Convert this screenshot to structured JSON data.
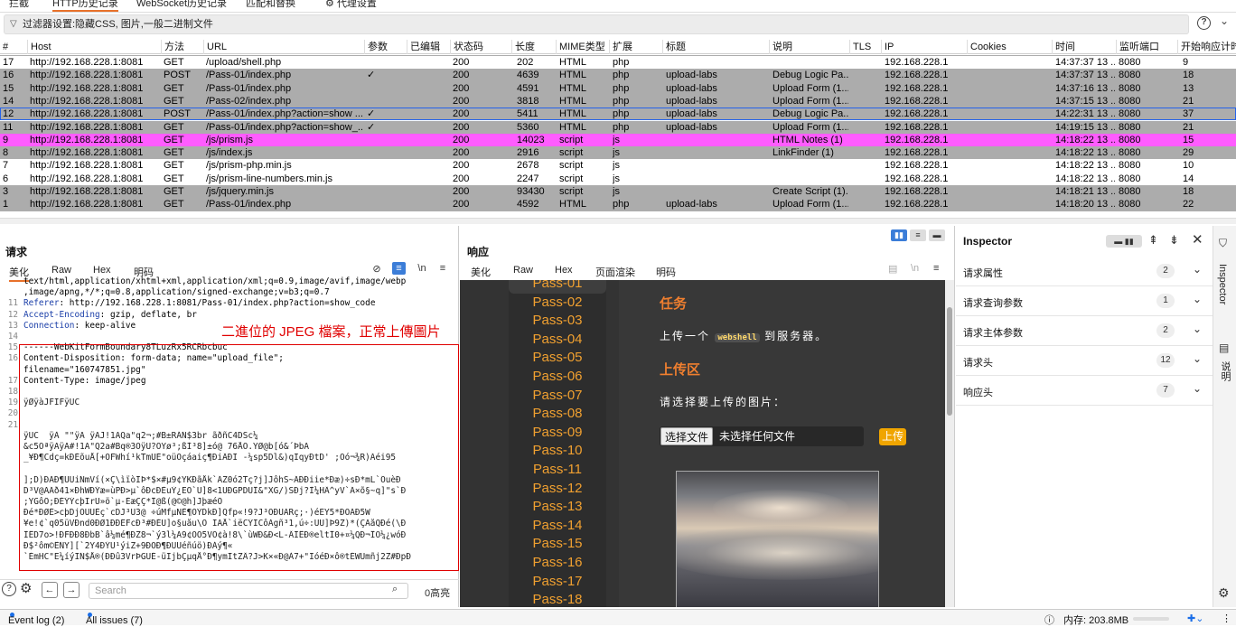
{
  "top_tabs": [
    "拦截",
    "HTTP历史记录",
    "WebSocket历史记录",
    "匹配和替换",
    "代理设置"
  ],
  "filter_text": "过滤器设置:隐藏CSS, 图片,一般二进制文件",
  "columns": [
    "#",
    "Host",
    "方法",
    "URL",
    "参数",
    "已编辑",
    "状态码",
    "长度",
    "MIME类型",
    "扩展",
    "标题",
    "说明",
    "TLS",
    "IP",
    "Cookies",
    "时间",
    "监听端口",
    "开始响应计时"
  ],
  "rows": [
    {
      "num": "17",
      "host": "http://192.168.228.1:8081",
      "method": "GET",
      "url": "/upload/shell.php",
      "params": "",
      "status": "200",
      "length": "202",
      "mime": "HTML",
      "ext": "php",
      "title": "",
      "comment": "",
      "ip": "192.168.228.1",
      "time": "14:37:37 13 ...",
      "port": "8080",
      "resp": "9",
      "style": "white"
    },
    {
      "num": "16",
      "host": "http://192.168.228.1:8081",
      "method": "POST",
      "url": "/Pass-01/index.php",
      "params": "✓",
      "status": "200",
      "length": "4639",
      "mime": "HTML",
      "ext": "php",
      "title": "upload-labs",
      "comment": "Debug Logic Pa...",
      "ip": "192.168.228.1",
      "time": "14:37:37 13 ...",
      "port": "8080",
      "resp": "18",
      "style": "gray"
    },
    {
      "num": "15",
      "host": "http://192.168.228.1:8081",
      "method": "GET",
      "url": "/Pass-01/index.php",
      "params": "",
      "status": "200",
      "length": "4591",
      "mime": "HTML",
      "ext": "php",
      "title": "upload-labs",
      "comment": "Upload Form (1...",
      "ip": "192.168.228.1",
      "time": "14:37:16 13 ...",
      "port": "8080",
      "resp": "13",
      "style": "gray"
    },
    {
      "num": "14",
      "host": "http://192.168.228.1:8081",
      "method": "GET",
      "url": "/Pass-02/index.php",
      "params": "",
      "status": "200",
      "length": "3818",
      "mime": "HTML",
      "ext": "php",
      "title": "upload-labs",
      "comment": "Upload Form (1...",
      "ip": "192.168.228.1",
      "time": "14:37:15 13 ...",
      "port": "8080",
      "resp": "21",
      "style": "gray"
    },
    {
      "num": "12",
      "host": "http://192.168.228.1:8081",
      "method": "POST",
      "url": "/Pass-01/index.php?action=show ...",
      "params": "✓",
      "status": "200",
      "length": "5411",
      "mime": "HTML",
      "ext": "php",
      "title": "upload-labs",
      "comment": "Debug Logic Pa...",
      "ip": "192.168.228.1",
      "time": "14:22:31 13 ...",
      "port": "8080",
      "resp": "37",
      "style": "gray sel"
    },
    {
      "num": "11",
      "host": "http://192.168.228.1:8081",
      "method": "GET",
      "url": "/Pass-01/index.php?action=show_...",
      "params": "✓",
      "status": "200",
      "length": "5360",
      "mime": "HTML",
      "ext": "php",
      "title": "upload-labs",
      "comment": "Upload Form (1...",
      "ip": "192.168.228.1",
      "time": "14:19:15 13 ...",
      "port": "8080",
      "resp": "21",
      "style": "gray"
    },
    {
      "num": "9",
      "host": "http://192.168.228.1:8081",
      "method": "GET",
      "url": "/js/prism.js",
      "params": "",
      "status": "200",
      "length": "14023",
      "mime": "script",
      "ext": "js",
      "title": "",
      "comment": "HTML Notes (1)",
      "ip": "192.168.228.1",
      "time": "14:18:22 13 ...",
      "port": "8080",
      "resp": "15",
      "style": "pink"
    },
    {
      "num": "8",
      "host": "http://192.168.228.1:8081",
      "method": "GET",
      "url": "/js/index.js",
      "params": "",
      "status": "200",
      "length": "2916",
      "mime": "script",
      "ext": "js",
      "title": "",
      "comment": "LinkFinder (1)",
      "ip": "192.168.228.1",
      "time": "14:18:22 13 ...",
      "port": "8080",
      "resp": "29",
      "style": "gray"
    },
    {
      "num": "7",
      "host": "http://192.168.228.1:8081",
      "method": "GET",
      "url": "/js/prism-php.min.js",
      "params": "",
      "status": "200",
      "length": "2678",
      "mime": "script",
      "ext": "js",
      "title": "",
      "comment": "",
      "ip": "192.168.228.1",
      "time": "14:18:22 13 ...",
      "port": "8080",
      "resp": "10",
      "style": "white"
    },
    {
      "num": "6",
      "host": "http://192.168.228.1:8081",
      "method": "GET",
      "url": "/js/prism-line-numbers.min.js",
      "params": "",
      "status": "200",
      "length": "2247",
      "mime": "script",
      "ext": "js",
      "title": "",
      "comment": "",
      "ip": "192.168.228.1",
      "time": "14:18:22 13 ...",
      "port": "8080",
      "resp": "14",
      "style": "white"
    },
    {
      "num": "3",
      "host": "http://192.168.228.1:8081",
      "method": "GET",
      "url": "/js/jquery.min.js",
      "params": "",
      "status": "200",
      "length": "93430",
      "mime": "script",
      "ext": "js",
      "title": "",
      "comment": "Create Script (1)...",
      "ip": "192.168.228.1",
      "time": "14:18:21 13 ...",
      "port": "8080",
      "resp": "18",
      "style": "gray"
    },
    {
      "num": "1",
      "host": "http://192.168.228.1:8081",
      "method": "GET",
      "url": "/Pass-01/index.php",
      "params": "",
      "status": "200",
      "length": "4592",
      "mime": "HTML",
      "ext": "php",
      "title": "upload-labs",
      "comment": "Upload Form (1...",
      "ip": "192.168.228.1",
      "time": "14:18:20 13 ...",
      "port": "8080",
      "resp": "22",
      "style": "gray"
    }
  ],
  "request": {
    "title": "请求",
    "tabs": [
      "美化",
      "Raw",
      "Hex",
      "明码"
    ],
    "annotation": "二進位的 JPEG 檔案，正常上傳圖片",
    "lines": [
      {
        "n": "",
        "t": "text/html,application/xhtml+xml,application/xml;q=0.9,image/avif,image/webp",
        "k": ""
      },
      {
        "n": "",
        "t": ",image/apng,*/*;q=0.8,application/signed-exchange;v=b3;q=0.7",
        "k": ""
      },
      {
        "n": "11",
        "t": ": http://192.168.228.1:8081/Pass-01/index.php?action=show_code",
        "k": "Referer"
      },
      {
        "n": "12",
        "t": ": gzip, deflate, br",
        "k": "Accept-Encoding"
      },
      {
        "n": "13",
        "t": ": keep-alive",
        "k": "Connection"
      },
      {
        "n": "14",
        "t": "",
        "k": ""
      },
      {
        "n": "15",
        "t": "------WebKitFormBoundary8TLuzRx5RCRbcbuc",
        "k": ""
      },
      {
        "n": "16",
        "t": "Content-Disposition: form-data; name=\"upload_file\";",
        "k": ""
      },
      {
        "n": "",
        "t": "filename=\"160747851.jpg\"",
        "k": ""
      },
      {
        "n": "17",
        "t": "Content-Type: image/jpeg",
        "k": ""
      },
      {
        "n": "18",
        "t": "",
        "k": ""
      },
      {
        "n": "19",
        "t": "ÿØÿàJFIFÿÛC",
        "k": ""
      },
      {
        "n": "20",
        "t": "",
        "k": ""
      },
      {
        "n": "21",
        "t": "",
        "k": ""
      },
      {
        "n": "",
        "t": "ÿÛC  ÿÀ \"\"ÿÄ ÿÄJ!1AQa\"q2¬;#B±RÁÑ$3br ãðñC4DSc¼",
        "k": ""
      },
      {
        "n": "",
        "t": "&c5ÖªÿÄÿÄ#!1A\"Q2a#Bq®3ÖÿÛ?ÒYø³;ßÌ³8]±ó@ 76ÅÒ.YØ@b[ó&´ÞbÄ",
        "k": ""
      },
      {
        "n": "",
        "t": "_¥Ð¶Cdç=kÐÉõuÅ[+ÖFWhí¹kTmÜÈ\"oüÕçáaiç¶ÐiÂÐÏ -¼sp5Dl&)qIqyÐtD' ;Öó¬¾R)Ãéi95",
        "k": ""
      },
      {
        "n": "",
        "t": "",
        "k": ""
      },
      {
        "n": "",
        "t": "];D)ÐAÐ¶ÛÜiNmVí(×Ç\\ìïòÏÞ*$×#µ9¢YKÐãÅk`ÃZ0ó2Tç?j]JôhS~ÃÐÐiie*Ðæ)÷sÐ*mL`ÕuèÐ",
        "k": ""
      },
      {
        "n": "",
        "t": "D³V@AÃð41×ÐhWÐÝæ=ùPÐ>µ`ôÐcÐÈuÝ¿ËÔ`U]8<1UÐGPDUÎ&\"XG/)SÐj?Ì¼HÂ^yV`Ã×õ§~q]\"s`Ð",
        "k": ""
      },
      {
        "n": "",
        "t": ";YGôÕ;ÐÉÝÝcþÏrÛ»ö`µ-ÈæÇÇ*Î@ß(@©@h]JþæéÕ",
        "k": ""
      },
      {
        "n": "",
        "t": "Ðé*ÐØÉ>cþDjÖÜÜÈç`cDJ³U3@ ÷úMfµNÈ¶ÖÝDkÐ]Qfp«!9?J³ÖÐÜÄRç;·)éEY5*ÐÖÃÐ5W",
        "k": ""
      },
      {
        "n": "",
        "t": "¥e!¢`q05üVÐnd0ÐØ1ÐÐÊFcÐ³#ÐÉU]o§uåu\\Ö ÏAÅ`iëCÝÏCôÄgñ³1,ú÷:ÛÛ]Þ9Z)*(ÇÄåQÐé(\\Ð",
        "k": ""
      },
      {
        "n": "",
        "t": "ÎÊD7o>!ÐFÐÐ8ÐbB`â¼mé¶ÐZ8¬`ý3l¼Ä9¢ÖÖ5VO¢à!8\\`ùWÐ&Ð<L-ÂÎÊÐ®eltÎ0+¤¼QÐ¬ÎÖ¼¿wóÐ",
        "k": ""
      },
      {
        "n": "",
        "t": "Ð$²ôm©ÊÑY][`2Y4ÐÝÙ¹ýiZ+9ÐÔÐ¶ÐÜÜéñúö)ÐÁý¶«",
        "k": ""
      },
      {
        "n": "",
        "t": "`ÈmHC\"Ë¼íýIÑ$Å®(ÐÐû3VrÞGÜÉ-üÏjbÇµqÅ°Ð¶ymÏtZÂ?J>K×«Ð@À7+\"IóéÐ×ô®tÉWUmñj2Z#ÐpÐ",
        "k": ""
      }
    ],
    "search_placeholder": "Search",
    "highlights": "0高亮"
  },
  "response": {
    "title": "响应",
    "tabs": [
      "美化",
      "Raw",
      "Hex",
      "页面渲染",
      "明码"
    ],
    "passes": [
      "Pass-01",
      "Pass-02",
      "Pass-03",
      "Pass-04",
      "Pass-05",
      "Pass-06",
      "Pass-07",
      "Pass-08",
      "Pass-09",
      "Pass-10",
      "Pass-11",
      "Pass-12",
      "Pass-13",
      "Pass-14",
      "Pass-15",
      "Pass-16",
      "Pass-17",
      "Pass-18"
    ],
    "task_heading": "任务",
    "task_pre": "上传一个",
    "task_code": "webshell",
    "task_post": "到服务器。",
    "upload_heading": "上传区",
    "choose_prompt": "请选择要上传的图片：",
    "choose_button": "选择文件",
    "no_file": "未选择任何文件",
    "upload_button": "上传"
  },
  "inspector": {
    "title": "Inspector",
    "items": [
      {
        "label": "请求属性",
        "count": "2"
      },
      {
        "label": "请求查询参数",
        "count": "1"
      },
      {
        "label": "请求主体参数",
        "count": "2"
      },
      {
        "label": "请求头",
        "count": "12"
      },
      {
        "label": "响应头",
        "count": "7"
      }
    ],
    "side_tabs": [
      "Inspector",
      "说明"
    ]
  },
  "status": {
    "event_log": "Event log (2)",
    "all_issues": "All issues (7)",
    "memory": "内存: 203.8MB"
  },
  "colors": {
    "accent": "#e8712a",
    "highlight_pink": "#ff5cff",
    "row_gray": "#acacac",
    "annotation": "#e00000",
    "pass_orange": "#f0a030"
  }
}
